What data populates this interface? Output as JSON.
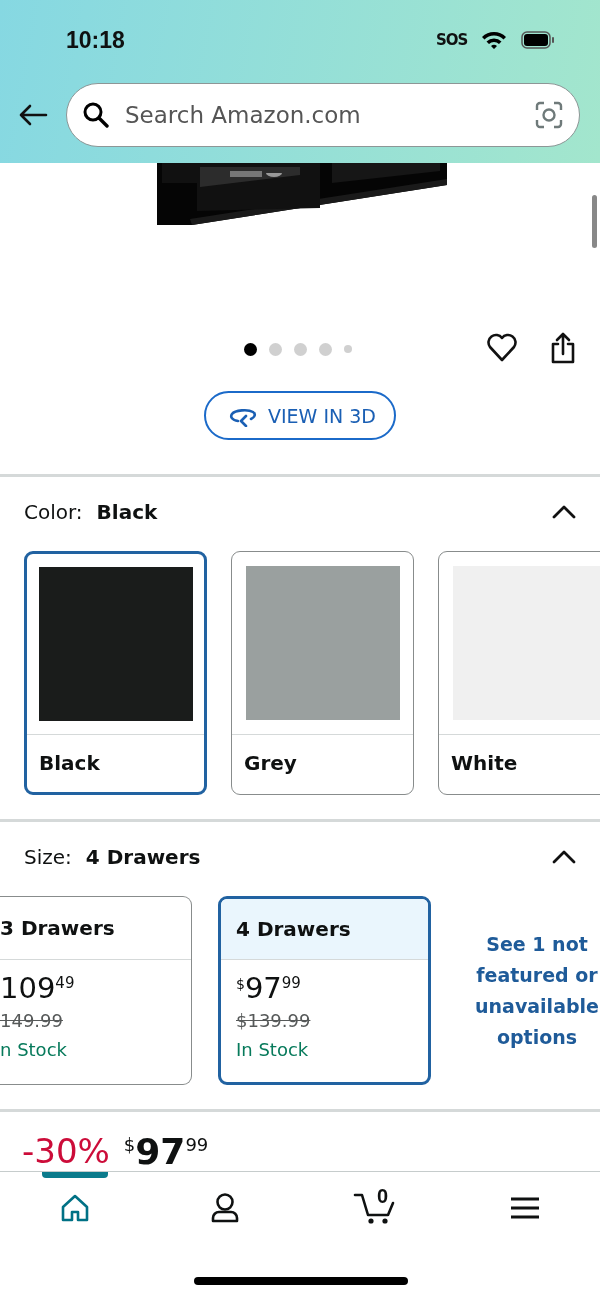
{
  "status_bar": {
    "time": "10:18",
    "signal_text": "SOS"
  },
  "search": {
    "placeholder": "Search Amazon.com"
  },
  "image_dots": [
    {
      "kind": "dot",
      "selected": true
    },
    {
      "kind": "dot",
      "selected": false
    },
    {
      "kind": "dot",
      "selected": false
    },
    {
      "kind": "dot",
      "selected": false
    },
    {
      "kind": "more",
      "selected": false
    }
  ],
  "view_3d_button": "VIEW IN 3D",
  "color_selector": {
    "label": "Color:",
    "value": "Black",
    "expanded": true,
    "options": [
      {
        "name": "Black",
        "color": "#1a1c1b",
        "selected": true
      },
      {
        "name": "Grey",
        "color": "#9aa09f",
        "selected": false
      },
      {
        "name": "White",
        "color": "#f0f0f0",
        "selected": false
      }
    ]
  },
  "size_selector": {
    "label": "Size:",
    "value": "4 Drawers",
    "expanded": true,
    "options": [
      {
        "name": "3 Drawers",
        "price_whole": "109",
        "price_fraction": "49",
        "list_price": "149.99",
        "availability": "n Stock",
        "selected": false
      },
      {
        "name": "4 Drawers",
        "currency": "$",
        "price_whole": "97",
        "price_fraction": "99",
        "list_price": "$139.99",
        "availability": "In Stock",
        "selected": true
      }
    ],
    "more_link": "See 1 not featured or unavailable options"
  },
  "price": {
    "discount": "-30%",
    "currency": "$",
    "whole": "97",
    "fraction": "99"
  },
  "bottom_nav": [
    {
      "kind": "home",
      "selected": true
    },
    {
      "kind": "account",
      "selected": false
    },
    {
      "kind": "cart",
      "count": "0",
      "selected": false
    },
    {
      "kind": "menu",
      "selected": false
    }
  ]
}
